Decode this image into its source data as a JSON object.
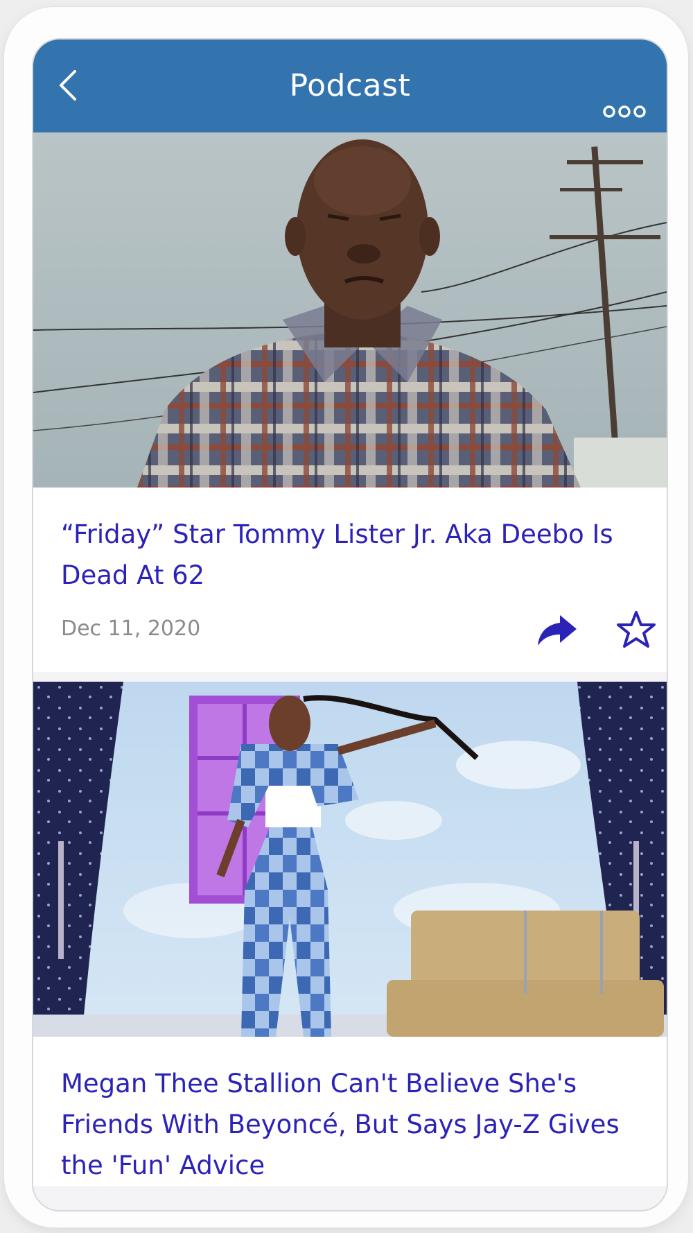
{
  "header": {
    "title": "Podcast",
    "back_icon": "chevron-left-icon",
    "more_icon": "more-horizontal-icon",
    "background_color": "#3474ae"
  },
  "feed": {
    "items": [
      {
        "title": "“Friday” Star Tommy Lister Jr. Aka Deebo Is Dead At 62",
        "date": "Dec 11, 2020",
        "share_icon": "share-arrow-icon",
        "favorite_icon": "star-outline-icon",
        "image_alt": "Man in plaid shirt in front of power lines"
      },
      {
        "title": "Megan Thee Stallion Can't Believe She's Friends With Beyoncé, But Says Jay-Z Gives the 'Fun' Advice",
        "image_alt": "Woman in patchwork denim outfit on stage with hay bales"
      }
    ]
  },
  "colors": {
    "title_text": "#2b22b8",
    "date_text": "#8a8a8a",
    "icon_accent": "#2b22b8"
  }
}
